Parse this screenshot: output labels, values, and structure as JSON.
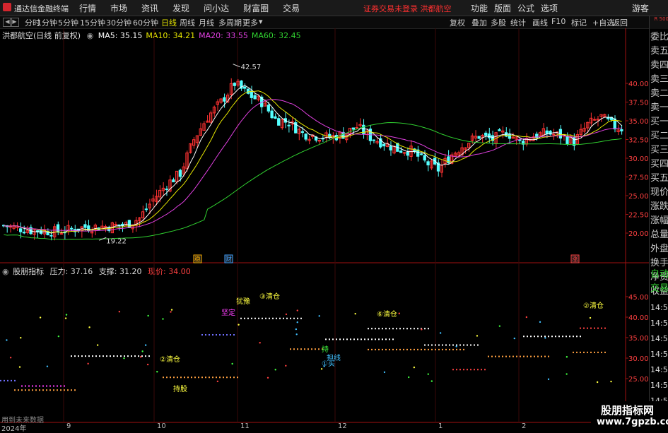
{
  "app": {
    "title": "通达信金融终端",
    "warning": "证券交易未登录  洪都航空",
    "guest": "游客"
  },
  "menu": [
    "行情",
    "市场",
    "资讯",
    "发现",
    "问小达",
    "财富圈",
    "交易"
  ],
  "right_menu": [
    "功能",
    "版面",
    "公式",
    "选项"
  ],
  "toolbar": {
    "periods": [
      "分时",
      "1分钟",
      "5分钟",
      "15分钟",
      "30分钟",
      "60分钟",
      "日线",
      "周线",
      "月线",
      "多周期",
      "更多"
    ],
    "selected": "日线",
    "right": [
      "复权",
      "叠加",
      "多股",
      "统计",
      "画线",
      "F10",
      "标记",
      "+自选",
      "返回"
    ]
  },
  "main_legend": {
    "stock": "洪都航空(日线 前复权)",
    "ma": [
      {
        "label": "MA5: 35.15",
        "color": "#ffffff"
      },
      {
        "label": "MA10: 34.21",
        "color": "#e6e600"
      },
      {
        "label": "MA20: 33.55",
        "color": "#e040e0"
      },
      {
        "label": "MA60: 32.45",
        "color": "#30d030"
      }
    ]
  },
  "main_axis": [
    "40.00",
    "37.50",
    "35.00",
    "32.50",
    "30.00",
    "27.50",
    "25.00",
    "22.50",
    "20.00"
  ],
  "main_marks": {
    "high": "42.57",
    "low": "19.22"
  },
  "event_tags": [
    "稳",
    "财",
    "涨"
  ],
  "indicator": {
    "name": "股朋指标",
    "pressure": "压力: 37.16",
    "support": "支撑: 31.20",
    "price": "现价: 34.00",
    "axis": [
      "45.00",
      "40.00",
      "35.00",
      "30.00",
      "25.00"
    ]
  },
  "indicator_labels": [
    {
      "text": "②清仓",
      "color": "#ffff40"
    },
    {
      "text": "坚定",
      "color": "#ff40ff"
    },
    {
      "text": "犹豫",
      "color": "#ffff40"
    },
    {
      "text": "③清仓",
      "color": "#ffff40"
    },
    {
      "text": "持股",
      "color": "#ffff40"
    },
    {
      "text": "①买",
      "color": "#40c0ff"
    },
    {
      "text": "⑥清仓",
      "color": "#ffff40"
    },
    {
      "text": "②清仓",
      "color": "#ffff40"
    },
    {
      "text": "持",
      "color": "#40ff40"
    },
    {
      "text": "担线",
      "color": "#40c0ff"
    }
  ],
  "right_panel": {
    "corner": "R 500",
    "items": [
      "委比",
      "卖五",
      "卖四",
      "卖三",
      "卖二",
      "卖一",
      "买一",
      "买二",
      "买三",
      "买四",
      "买五",
      "现价",
      "涨跌",
      "涨幅",
      "总量",
      "外盘",
      "换手",
      "净资",
      "收益"
    ],
    "lower": [
      "自动",
      "交易"
    ],
    "times": [
      "14:56",
      "14:56",
      "14:56",
      "14:56",
      "14:56",
      "14:56",
      "14:56",
      "14:56"
    ]
  },
  "x_axis": [
    "2024年",
    "9",
    "10",
    "11",
    "12",
    "1",
    "2"
  ],
  "footer_hint": "用到未来数据",
  "watermark": {
    "title": "股朋指标网",
    "url": "www.7gpzb.com"
  }
}
